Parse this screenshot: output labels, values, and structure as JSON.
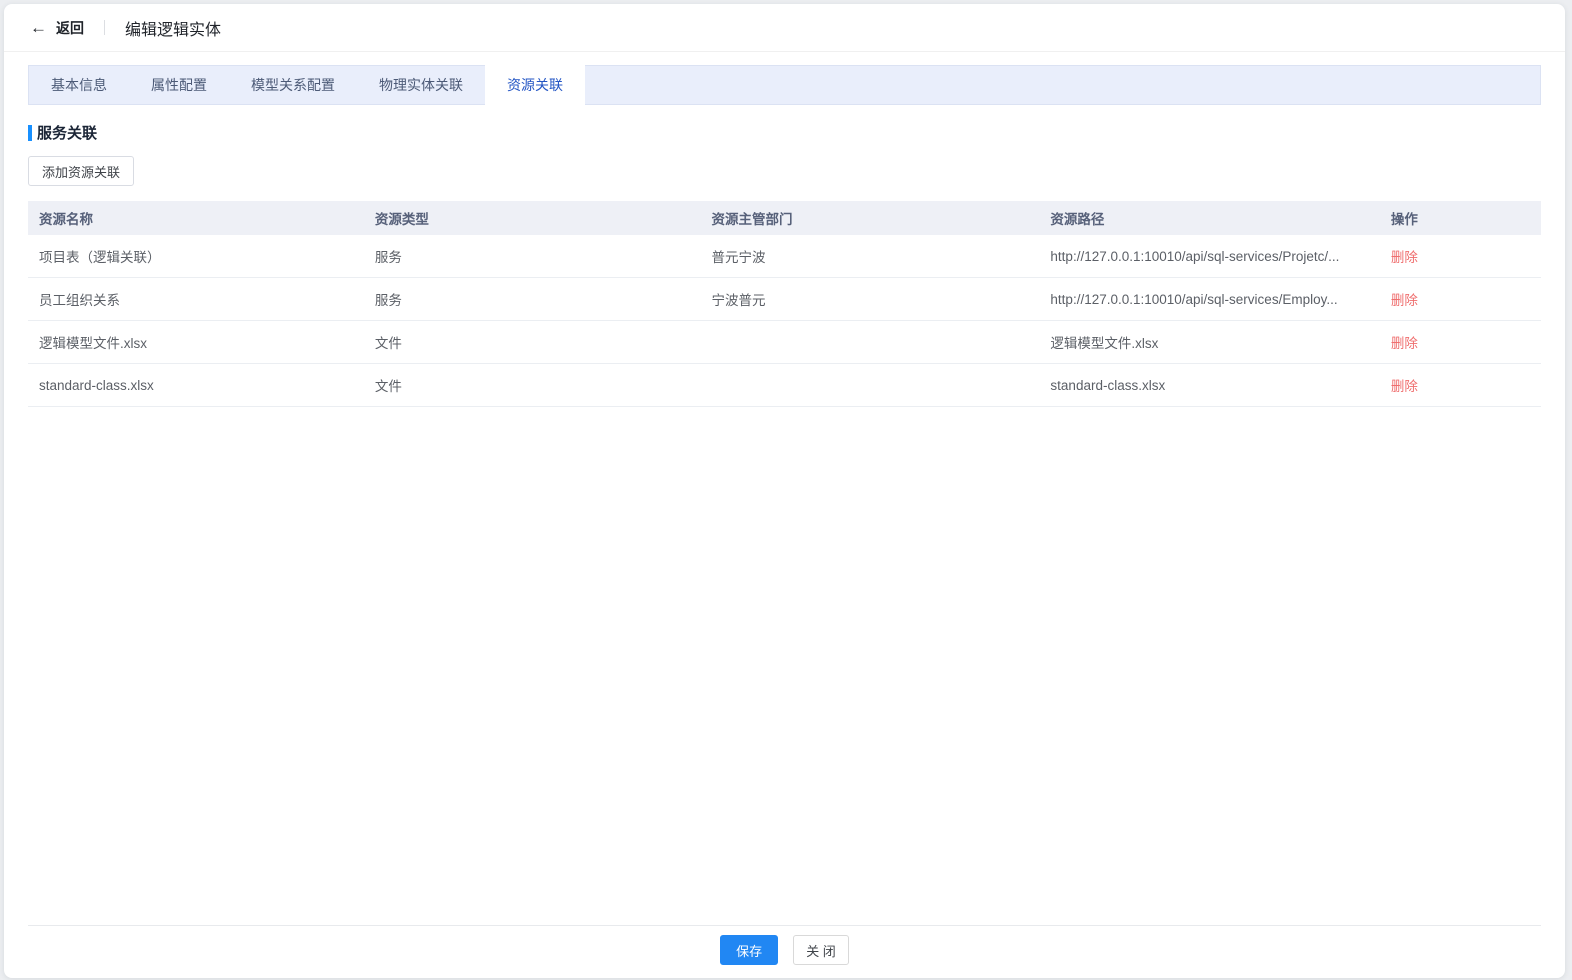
{
  "header": {
    "back_label": "返回",
    "title": "编辑逻辑实体"
  },
  "tabs": {
    "items": [
      {
        "label": "基本信息",
        "active": false
      },
      {
        "label": "属性配置",
        "active": false
      },
      {
        "label": "模型关系配置",
        "active": false
      },
      {
        "label": "物理实体关联",
        "active": false
      },
      {
        "label": "资源关联",
        "active": true
      }
    ]
  },
  "section": {
    "title": "服务关联",
    "add_button_label": "添加资源关联"
  },
  "table": {
    "columns": [
      "资源名称",
      "资源类型",
      "资源主管部门",
      "资源路径",
      "操作"
    ],
    "rows": [
      {
        "name": "项目表（逻辑关联）",
        "type": "服务",
        "department": "普元宁波",
        "path": "http://127.0.0.1:10010/api/sql-services/Projetc/...",
        "action": "删除"
      },
      {
        "name": "员工组织关系",
        "type": "服务",
        "department": "宁波普元",
        "path": "http://127.0.0.1:10010/api/sql-services/Employ...",
        "action": "删除"
      },
      {
        "name": "逻辑模型文件.xlsx",
        "type": "文件",
        "department": "",
        "path": "逻辑模型文件.xlsx",
        "action": "删除"
      },
      {
        "name": "standard-class.xlsx",
        "type": "文件",
        "department": "",
        "path": "standard-class.xlsx",
        "action": "删除"
      }
    ]
  },
  "footer": {
    "save_label": "保存",
    "close_label": "关 闭"
  },
  "colors": {
    "accent_blue": "#1890ff",
    "active_tab_text": "#2355c4",
    "tabbar_bg": "#e9eefb",
    "delete_red": "#ef6e6e",
    "save_button_bg": "#2187f3"
  }
}
